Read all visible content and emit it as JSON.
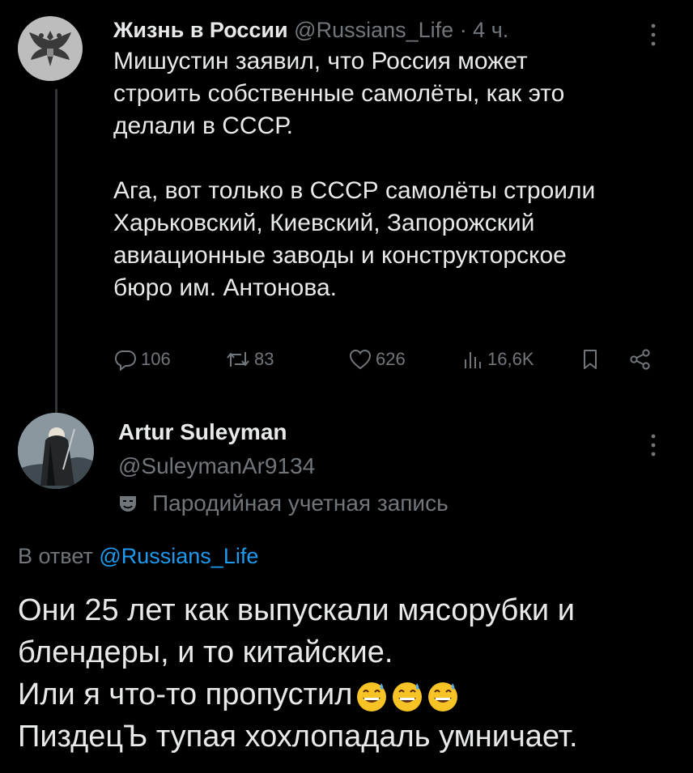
{
  "parent_tweet": {
    "author_name": "Жизнь в России",
    "author_handle": "@Russians_Life",
    "time": "· 4 ч.",
    "text": "Мишустин заявил, что Россия может\nстроить собственные самолёты, как это\nделали в СССР.\n\nАга, вот только в СССР самолёты строили\nХарьковский, Киевский, Запорожский\nавиационные заводы и конструкторское\nбюро им. Антонова.",
    "stats": {
      "replies": "106",
      "retweets": "83",
      "likes": "626",
      "views": "16,6K"
    }
  },
  "reply": {
    "author_name": "Artur Suleyman",
    "author_handle": "@SuleymanAr9134",
    "parody_label": "Пародийная учетная запись",
    "reply_prefix": "В ответ",
    "reply_to_handle": "@Russians_Life",
    "lines": [
      "Они 25 лет как выпускали мясорубки и",
      "блендеры, и то китайские.",
      "Или я что-то пропустил",
      "ПиздецЪ тупая хохлопадаль умничает."
    ]
  },
  "icons": {
    "reply": "reply-icon",
    "retweet": "retweet-icon",
    "like": "heart-icon",
    "views": "views-chart-icon",
    "bookmark": "bookmark-icon",
    "share": "share-icon",
    "more": "more-vertical-icon",
    "parody": "mask-icon",
    "emoji": "grinning-face-with-sweat-emoji"
  },
  "colors": {
    "background": "#000000",
    "text": "#e7e9ea",
    "muted": "#71767b",
    "link": "#1d9bf0"
  }
}
